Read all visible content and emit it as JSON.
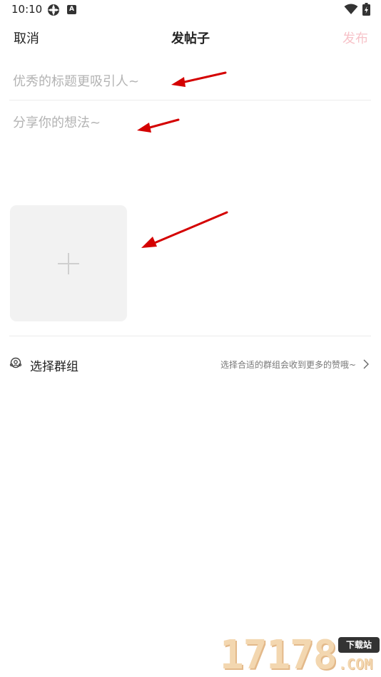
{
  "status_bar": {
    "time": "10:10",
    "icons": [
      "settings-icon",
      "a-badge-icon",
      "wifi-icon",
      "battery-icon"
    ],
    "a_badge": "A"
  },
  "header": {
    "cancel_label": "取消",
    "title": "发帖子",
    "publish_label": "发布",
    "publish_color": "#f7c3c9"
  },
  "post_form": {
    "title_placeholder": "优秀的标题更吸引人~",
    "content_placeholder": "分享你的想法~",
    "add_image_icon": "plus-icon"
  },
  "group_selector": {
    "label": "选择群组",
    "hint": "选择合适的群组会收到更多的赞哦~",
    "icon": "group-icon"
  },
  "annotations": {
    "arrow_color": "#d40000",
    "count": 3
  },
  "watermark": {
    "digits": "17178",
    "badge": "下载站",
    "suffix": ".COM"
  }
}
